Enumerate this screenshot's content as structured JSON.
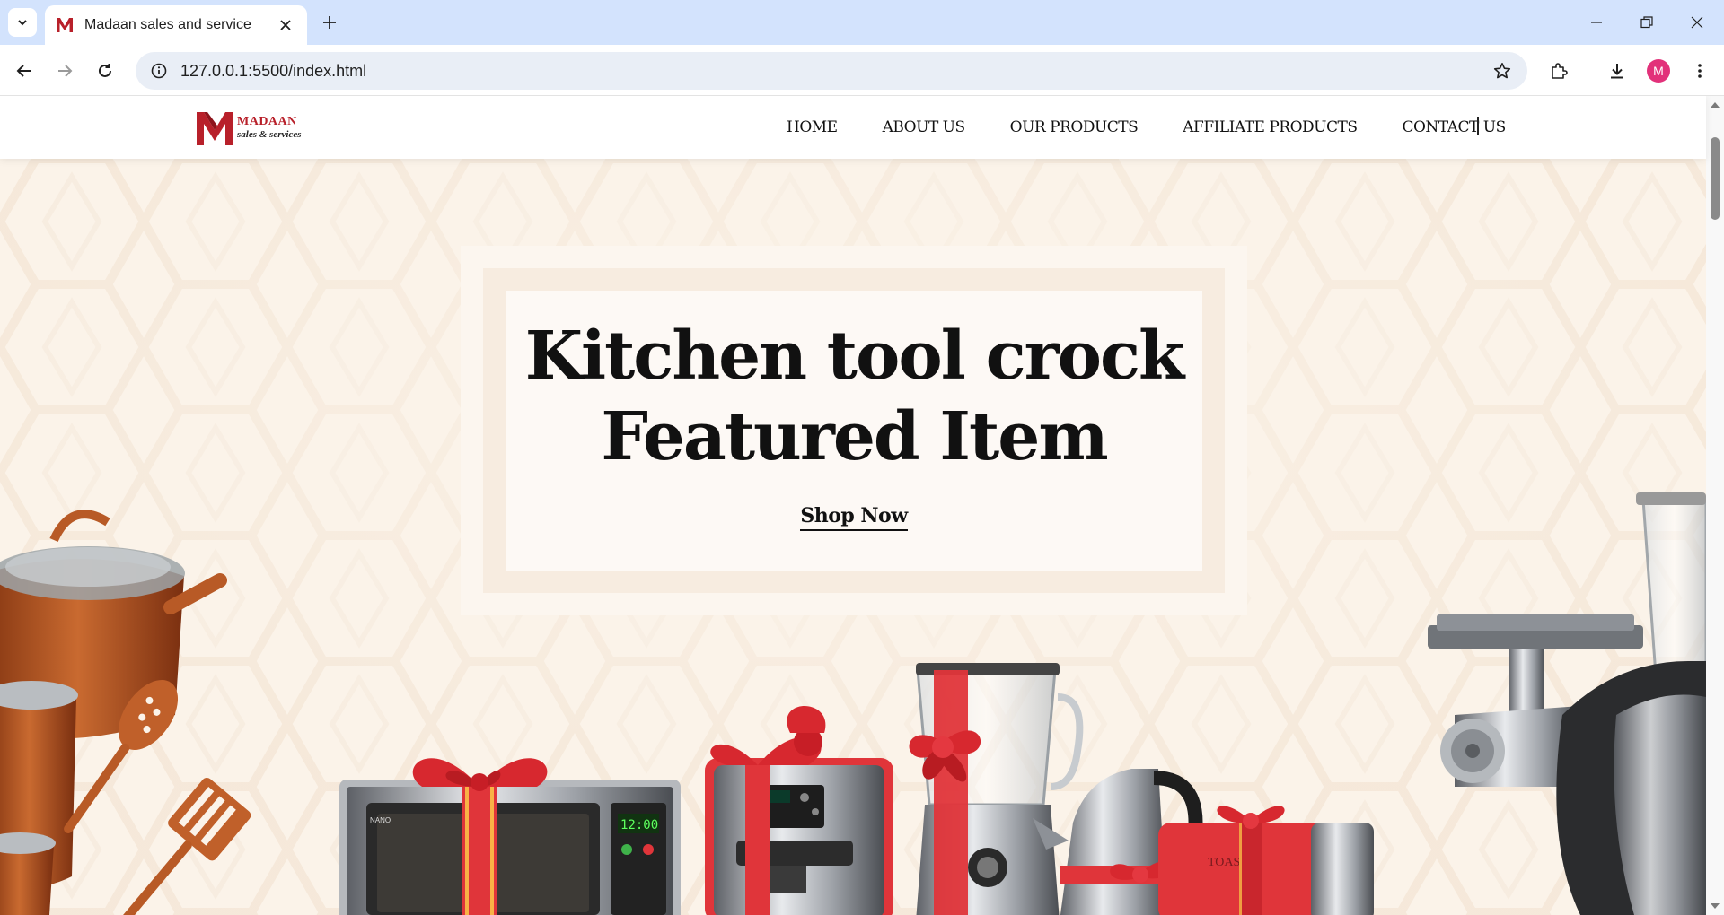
{
  "browser": {
    "tab_title": "Madaan sales and service",
    "url": "127.0.0.1:5500/index.html",
    "profile_initial": "M"
  },
  "site": {
    "logo": {
      "name": "MADAAN",
      "tagline": "sales & services"
    },
    "nav": [
      "HOME",
      "ABOUT US",
      "OUR PRODUCTS",
      "AFFILIATE PRODUCTS",
      "CONTACT US"
    ]
  },
  "hero": {
    "title_line1": "Kitchen tool crock",
    "title_line2": "Featured Item",
    "cta": "Shop Now",
    "appliance_labels": {
      "microwave_brand": "NANO",
      "microwave_time": "12:00",
      "toaster_brand": "TOAST"
    }
  },
  "colors": {
    "tabstrip": "#d3e3fd",
    "brand_red": "#b8202a",
    "hero_bg": "#fbf3e9",
    "ribbon_red": "#e0353a",
    "copper": "#b85a26"
  }
}
